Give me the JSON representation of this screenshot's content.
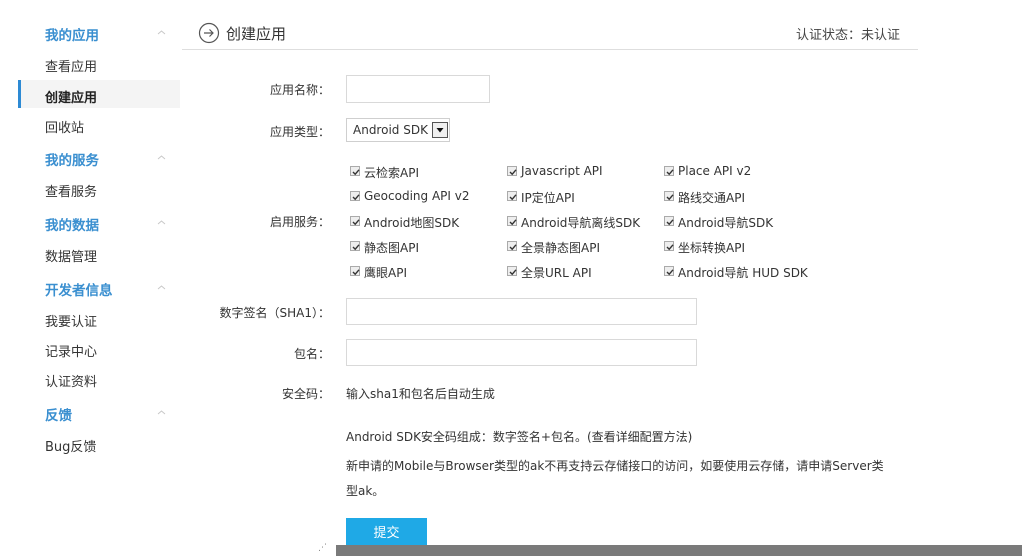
{
  "sidebar": {
    "sections": [
      {
        "title": "我的应用",
        "items": [
          "查看应用",
          "创建应用",
          "回收站"
        ]
      },
      {
        "title": "我的服务",
        "items": [
          "查看服务"
        ]
      },
      {
        "title": "我的数据",
        "items": [
          "数据管理"
        ]
      },
      {
        "title": "开发者信息",
        "items": [
          "我要认证",
          "记录中心",
          "认证资料"
        ]
      },
      {
        "title": "反馈",
        "items": [
          "Bug反馈"
        ]
      }
    ],
    "active_item": "创建应用"
  },
  "header": {
    "title": "创建应用",
    "status": "认证状态：未认证"
  },
  "form": {
    "app_name_label": "应用名称：",
    "app_name_value": "",
    "app_type_label": "应用类型：",
    "app_type_value": "Android SDK",
    "services_label": "启用服务：",
    "services": [
      {
        "label": "云检索API",
        "checked": true
      },
      {
        "label": "Javascript API",
        "checked": true
      },
      {
        "label": "Place API v2",
        "checked": true
      },
      {
        "label": "Geocoding API v2",
        "checked": true
      },
      {
        "label": "IP定位API",
        "checked": true
      },
      {
        "label": "路线交通API",
        "checked": true
      },
      {
        "label": "Android地图SDK",
        "checked": true
      },
      {
        "label": "Android导航离线SDK",
        "checked": true
      },
      {
        "label": "Android导航SDK",
        "checked": true
      },
      {
        "label": "静态图API",
        "checked": true
      },
      {
        "label": "全景静态图API",
        "checked": true
      },
      {
        "label": "坐标转换API",
        "checked": true
      },
      {
        "label": "鹰眼API",
        "checked": true
      },
      {
        "label": "全景URL API",
        "checked": true
      },
      {
        "label": "Android导航 HUD SDK",
        "checked": true
      }
    ],
    "sha1_label": "数字签名（SHA1）：",
    "sha1_value": "",
    "package_label": "包名：",
    "package_value": "",
    "security_label": "安全码：",
    "security_value": "输入sha1和包名后自动生成",
    "note1": "Android SDK安全码组成：数字签名+包名。(查看详细配置方法)",
    "note2_line1": "新申请的Mobile与Browser类型的ak不再支持云存储接口的访问，如要使用云存储，请申请Server类",
    "note2_line2": "型ak。",
    "submit_label": "提交"
  },
  "colors": {
    "section_title": "#3a8fd0",
    "active_bar": "#2d8ad4",
    "submit_bg": "#1fa9e6"
  }
}
